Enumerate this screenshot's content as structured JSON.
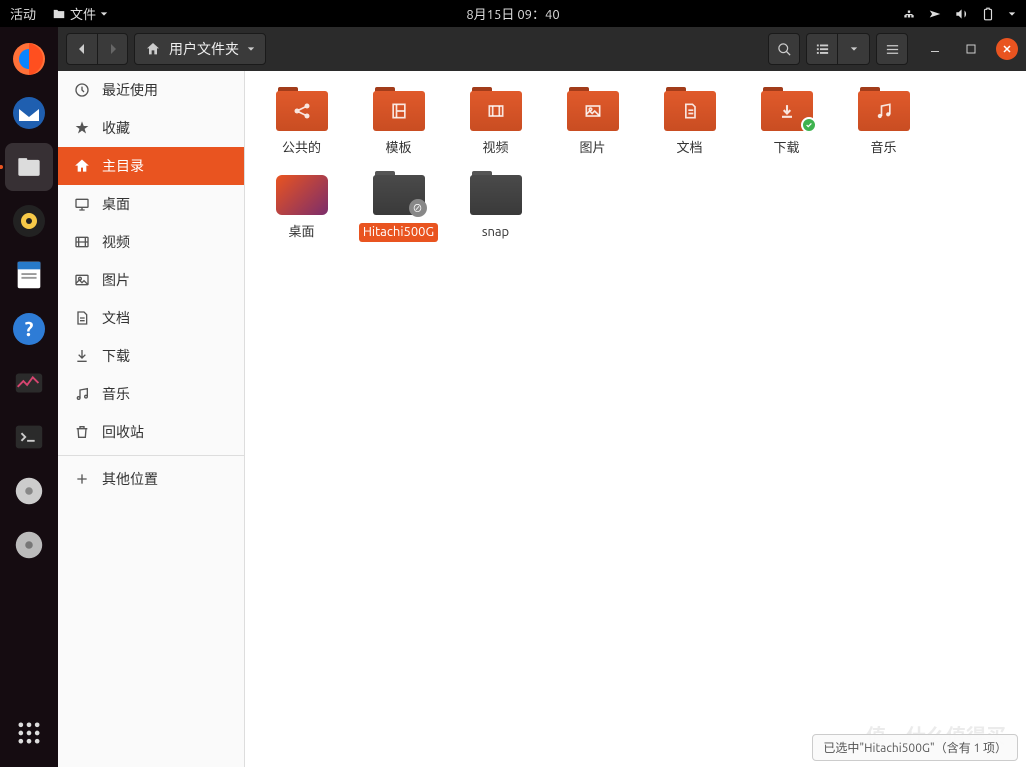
{
  "topbar": {
    "activities": "活动",
    "app_menu": "文件",
    "datetime": "8月15日 09：40"
  },
  "window": {
    "path_label": "用户文件夹"
  },
  "sidebar": {
    "items": [
      {
        "id": "recent",
        "label": "最近使用"
      },
      {
        "id": "starred",
        "label": "收藏"
      },
      {
        "id": "home",
        "label": "主目录"
      },
      {
        "id": "desktop",
        "label": "桌面"
      },
      {
        "id": "videos",
        "label": "视频"
      },
      {
        "id": "pictures",
        "label": "图片"
      },
      {
        "id": "documents",
        "label": "文档"
      },
      {
        "id": "downloads",
        "label": "下载"
      },
      {
        "id": "music",
        "label": "音乐"
      },
      {
        "id": "trash",
        "label": "回收站"
      },
      {
        "id": "other",
        "label": "其他位置"
      }
    ]
  },
  "files": [
    {
      "name": "公共的",
      "type": "share"
    },
    {
      "name": "模板",
      "type": "templates"
    },
    {
      "name": "视频",
      "type": "videos"
    },
    {
      "name": "图片",
      "type": "pictures"
    },
    {
      "name": "文档",
      "type": "documents"
    },
    {
      "name": "下载",
      "type": "downloads"
    },
    {
      "name": "音乐",
      "type": "music"
    },
    {
      "name": "桌面",
      "type": "desktop"
    },
    {
      "name": "Hitachi500G",
      "type": "disk",
      "selected": true
    },
    {
      "name": "snap",
      "type": "plain"
    }
  ],
  "statusbar": "已选中\"Hitachi500G\"（含有 1 项）",
  "watermark": "值，什么值得买"
}
